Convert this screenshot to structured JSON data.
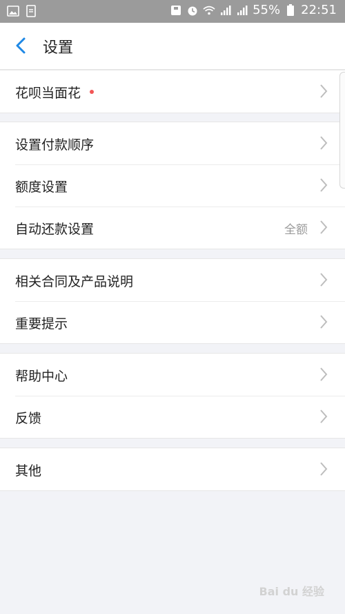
{
  "status_bar": {
    "battery": "55%",
    "time": "22:51"
  },
  "header": {
    "title": "设置"
  },
  "sections": [
    {
      "items": [
        {
          "label": "花呗当面花",
          "has_badge": true
        }
      ]
    },
    {
      "items": [
        {
          "label": "设置付款顺序"
        },
        {
          "label": "额度设置"
        },
        {
          "label": "自动还款设置",
          "value": "全额"
        }
      ]
    },
    {
      "items": [
        {
          "label": "相关合同及产品说明"
        },
        {
          "label": "重要提示"
        }
      ]
    },
    {
      "items": [
        {
          "label": "帮助中心"
        },
        {
          "label": "反馈"
        }
      ]
    },
    {
      "items": [
        {
          "label": "其他"
        }
      ]
    }
  ],
  "watermark": "Bai du 经验",
  "colors": {
    "accent": "#1e88e5",
    "badge": "#f25656",
    "background": "#f2f3f7"
  }
}
